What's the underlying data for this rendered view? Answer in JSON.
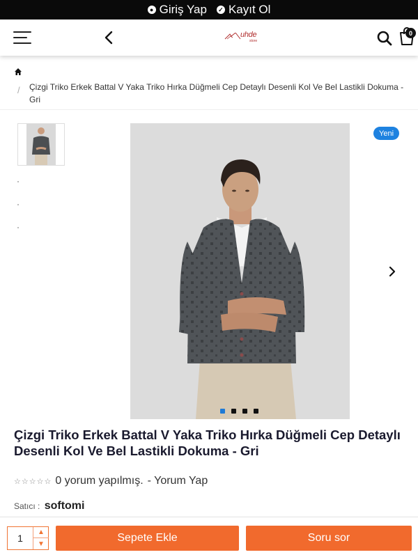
{
  "topbar": {
    "login_label": "Giriş Yap",
    "register_label": "Kayıt Ol"
  },
  "header": {
    "logo_text": "uhde",
    "logo_sub": "store",
    "cart_count": "0"
  },
  "breadcrumb": {
    "separator": "/",
    "current": "Çizgi Triko Erkek Battal V Yaka Triko Hırka Düğmeli Cep Detaylı Desenli Kol Ve Bel Lastikli Dokuma - Gri"
  },
  "product": {
    "badge": "Yeni",
    "title": "Çizgi Triko Erkek Battal V Yaka Triko Hırka Düğmeli Cep Detaylı Desenli Kol Ve Bel Lastikli Dokuma - Gri",
    "review_text": "0 yorum yapılmış.",
    "review_link": "- Yorum Yap",
    "seller_label": "Satıcı :",
    "seller_name": "softomi",
    "rating": 0,
    "rating_max": 5
  },
  "gallery": {
    "slide_count": 4,
    "active_slide": 1
  },
  "bottom_bar": {
    "quantity": "1",
    "add_to_cart_label": "Sepete Ekle",
    "ask_label": "Soru sor"
  },
  "colors": {
    "accent": "#f16a2d",
    "badge": "#1e82e0",
    "topbar": "#0a0a0a"
  },
  "icons": [
    "user-circle-icon",
    "check-circle-icon",
    "hamburger-menu-icon",
    "chevron-left-icon",
    "search-icon",
    "shopping-bag-icon",
    "home-icon",
    "chevron-right-icon",
    "star-outline-icon",
    "chevron-up-icon",
    "chevron-down-icon"
  ]
}
